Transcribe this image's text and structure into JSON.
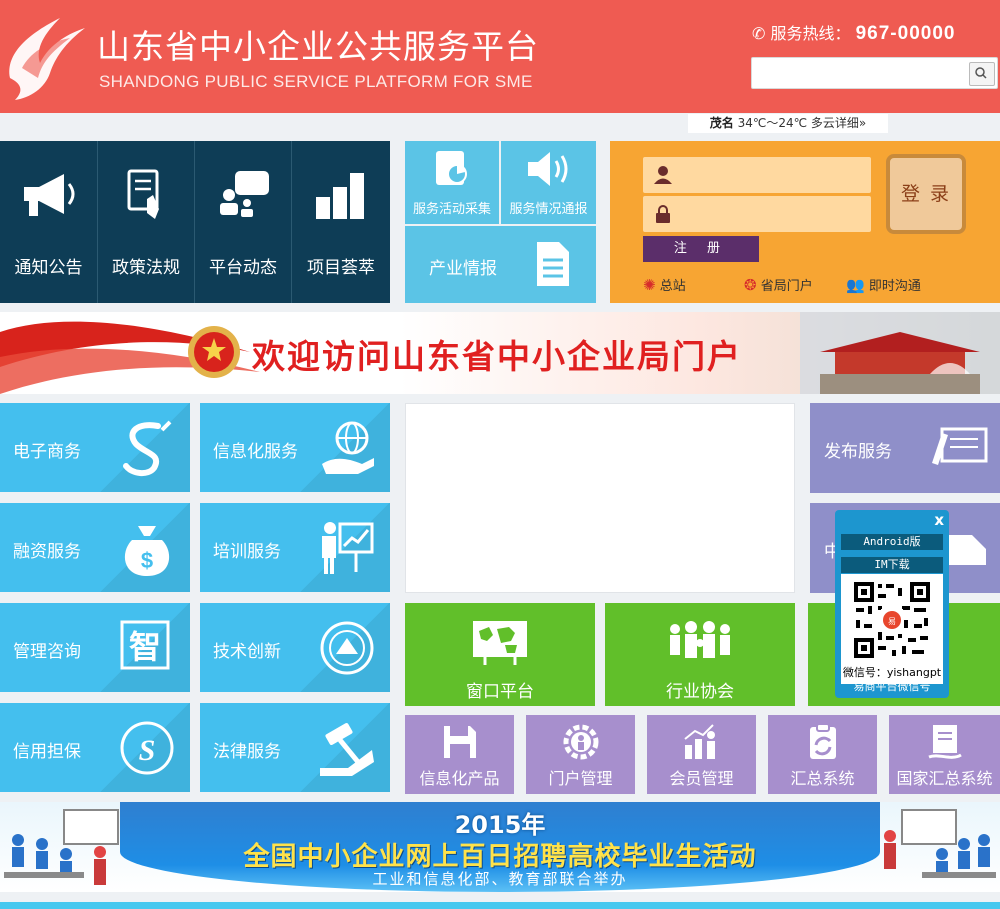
{
  "header": {
    "title": "山东省中小企业公共服务平台",
    "subtitle": "SHANDONG PUBLIC SERVICE PLATFORM FOR SME",
    "hotline_label": "服务热线：",
    "hotline_number": "967-00000",
    "search_placeholder": ""
  },
  "weather": {
    "city": "茂名",
    "text": "34℃～24℃ 多云详细»"
  },
  "nav_tiles": [
    {
      "label": "通知公告",
      "icon": "megaphone-icon"
    },
    {
      "label": "政策法规",
      "icon": "document-hand-icon"
    },
    {
      "label": "平台动态",
      "icon": "chat-people-icon"
    },
    {
      "label": "项目荟萃",
      "icon": "boxes-icon"
    }
  ],
  "quick_tiles": [
    {
      "label": "服务活动采集",
      "icon": "chart-doc-icon"
    },
    {
      "label": "服务情况通报",
      "icon": "speaker-icon"
    },
    {
      "label": "产业情报",
      "icon": "doc-list-icon"
    }
  ],
  "login": {
    "username_placeholder": "",
    "password_placeholder": "",
    "login_label": "登 录",
    "register_label": "注 册",
    "links": [
      {
        "label": "总站",
        "icon": "globe-icon"
      },
      {
        "label": "省局门户",
        "icon": "emblem-icon"
      },
      {
        "label": "即时沟通",
        "icon": "people-icon"
      }
    ]
  },
  "banner": {
    "welcome": "欢迎访问山东省中小企业局门户"
  },
  "services": [
    {
      "label": "电子商务",
      "icon": "s-swirl-icon"
    },
    {
      "label": "信息化服务",
      "icon": "globe-hand-icon"
    },
    {
      "label": "融资服务",
      "icon": "money-bag-icon"
    },
    {
      "label": "培训服务",
      "icon": "teacher-icon"
    },
    {
      "label": "管理咨询",
      "icon": "zhi-icon"
    },
    {
      "label": "技术创新",
      "icon": "badge-icon"
    },
    {
      "label": "信用担保",
      "icon": "s-seal-icon"
    },
    {
      "label": "法律服务",
      "icon": "gavel-icon"
    }
  ],
  "right_tiles": [
    {
      "label": "发布服务",
      "icon": "pen-doc-icon"
    },
    {
      "label": "中",
      "icon": "tray-icon"
    }
  ],
  "green_tiles": [
    {
      "label": "窗口平台",
      "icon": "world-map-icon"
    },
    {
      "label": "行业协会",
      "icon": "crowd-icon"
    },
    {
      "label": "",
      "icon": ""
    }
  ],
  "violet_tiles": [
    {
      "label": "信息化产品",
      "icon": "floppy-icon"
    },
    {
      "label": "门户管理",
      "icon": "gear-person-icon"
    },
    {
      "label": "会员管理",
      "icon": "growth-icon"
    },
    {
      "label": "汇总系统",
      "icon": "clipboard-icon"
    },
    {
      "label": "国家汇总系统",
      "icon": "doc-stack-icon"
    }
  ],
  "wechat": {
    "close": "x",
    "android": "Android版",
    "im": "IM下载",
    "id": "微信号：yishangpt",
    "caption": "易商平台微信号"
  },
  "recruit": {
    "year": "2015年",
    "title": "全国中小企业网上百日招聘高校毕业生活动",
    "sub": "工业和信息化部、教育部联合举办"
  }
}
